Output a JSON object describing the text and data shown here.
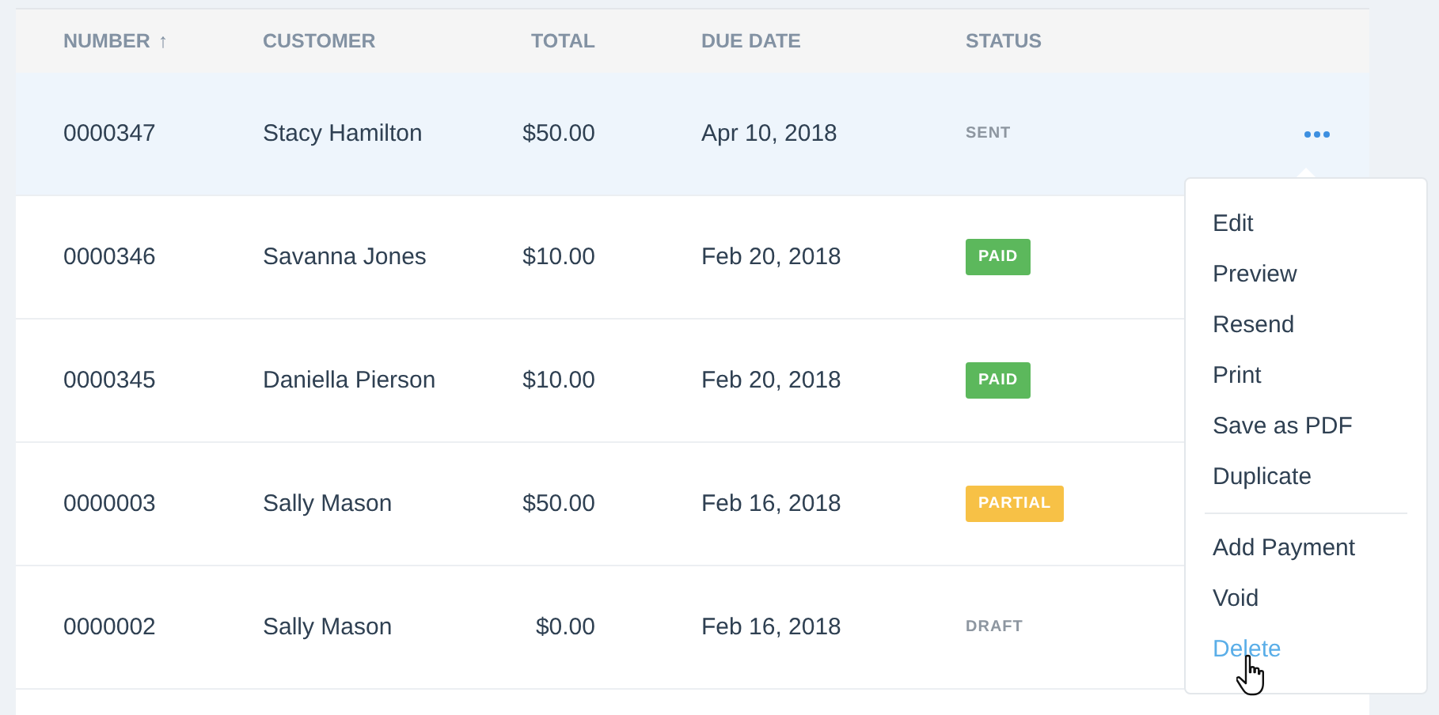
{
  "table": {
    "columns": [
      {
        "label": "NUMBER",
        "sort_arrow": "↑"
      },
      {
        "label": "CUSTOMER"
      },
      {
        "label": "TOTAL"
      },
      {
        "label": "DUE DATE"
      },
      {
        "label": "STATUS"
      }
    ],
    "rows": [
      {
        "number": "0000347",
        "customer": "Stacy Hamilton",
        "total": "$50.00",
        "due_date": "Apr 10, 2018",
        "status": {
          "label": "SENT",
          "kind": "sent"
        },
        "highlighted": true
      },
      {
        "number": "0000346",
        "customer": "Savanna Jones",
        "total": "$10.00",
        "due_date": "Feb 20, 2018",
        "status": {
          "label": "PAID",
          "kind": "paid"
        },
        "highlighted": false
      },
      {
        "number": "0000345",
        "customer": "Daniella Pierson",
        "total": "$10.00",
        "due_date": "Feb 20, 2018",
        "status": {
          "label": "PAID",
          "kind": "paid"
        },
        "highlighted": false
      },
      {
        "number": "0000003",
        "customer": "Sally Mason",
        "total": "$50.00",
        "due_date": "Feb 16, 2018",
        "status": {
          "label": "PARTIAL",
          "kind": "partial"
        },
        "highlighted": false
      },
      {
        "number": "0000002",
        "customer": "Sally Mason",
        "total": "$0.00",
        "due_date": "Feb 16, 2018",
        "status": {
          "label": "DRAFT",
          "kind": "draft"
        },
        "highlighted": false
      }
    ]
  },
  "menu": {
    "groups": [
      [
        {
          "label": "Edit",
          "hovered": false
        },
        {
          "label": "Preview",
          "hovered": false
        },
        {
          "label": "Resend",
          "hovered": false
        },
        {
          "label": "Print",
          "hovered": false
        },
        {
          "label": "Save as PDF",
          "hovered": false
        },
        {
          "label": "Duplicate",
          "hovered": false
        }
      ],
      [
        {
          "label": "Add Payment",
          "hovered": false
        },
        {
          "label": "Void",
          "hovered": false
        },
        {
          "label": "Delete",
          "hovered": true
        }
      ]
    ]
  }
}
